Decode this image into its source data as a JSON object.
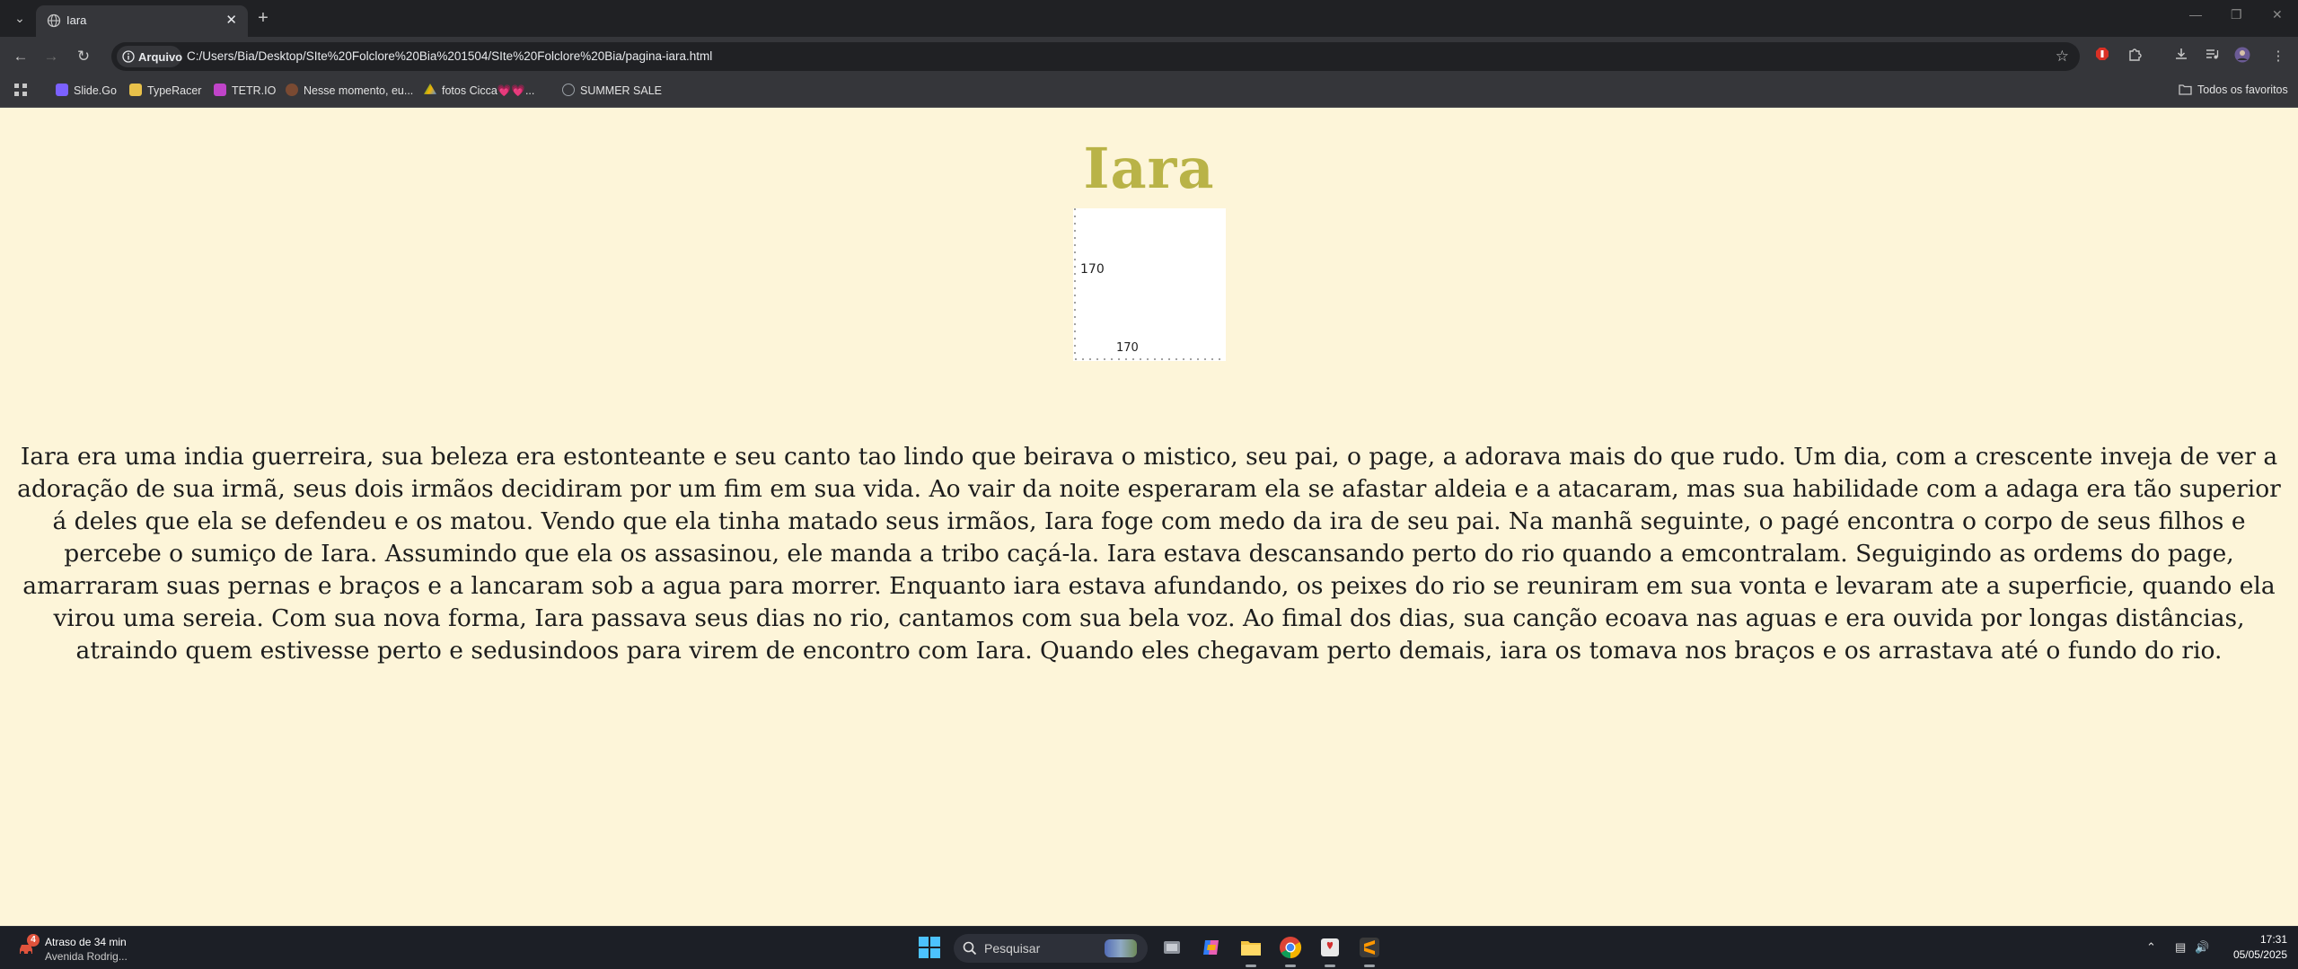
{
  "browser": {
    "tab_title": "Iara",
    "address_chip": "Arquivo",
    "url": "C:/Users/Bia/Desktop/SIte%20Folclore%20Bia%201504/SIte%20Folclore%20Bia/pagina-iara.html",
    "bookmarks": [
      {
        "label": "Slide.Go",
        "icon": "slidesgo-icon",
        "color": "#7b61ff"
      },
      {
        "label": "TypeRacer",
        "icon": "typeracer-car-icon",
        "color": "#e8c14a"
      },
      {
        "label": "TETR.IO",
        "icon": "tetrio-icon",
        "color": "#c044c9"
      },
      {
        "label": "Nesse momento, eu...",
        "icon": "avatar-icon",
        "color": "#7a4a32"
      },
      {
        "label": "fotos Cicca💗💗...",
        "icon": "google-drive-icon",
        "color": "#f4b400"
      },
      {
        "label": "SUMMER SALE",
        "icon": "globe-icon",
        "color": "#9aa0a6"
      }
    ],
    "all_bookmarks": "Todos os favoritos"
  },
  "page": {
    "title": "Iara",
    "sketch_label_left": "170",
    "sketch_label_bottom": "170",
    "story": "Iara era uma india guerreira, sua beleza era estonteante e seu canto tao lindo que beirava o mistico, seu pai, o page, a adorava mais do que rudo. Um dia, com a crescente inveja de ver a adoração de sua irmã, seus dois irmãos decidiram por um fim em sua vida. Ao vair da noite esperaram ela se afastar aldeia e a atacaram, mas sua habilidade com a adaga era tão superior á deles que ela se defendeu e os matou. Vendo que ela tinha matado seus irmãos, Iara foge com medo da ira de seu pai. Na manhã seguinte, o pagé encontra o corpo de seus filhos e percebe o sumiço de Iara. Assumindo que ela os assasinou, ele manda a tribo caçá-la. Iara estava descansando perto do rio quando a emcontralam. Seguigindo as ordems do page, amarraram suas pernas e braços e a lancaram sob a agua para morrer. Enquanto iara estava afundando, os peixes do rio se reuniram em sua vonta e levaram ate a superficie, quando ela virou uma sereia. Com sua nova forma, Iara passava seus dias no rio, cantamos com sua bela voz. Ao fimal dos dias, sua canção ecoava nas aguas e era ouvida por longas distâncias, atraindo quem estivesse perto e sedusindoos para virem de encontro com Iara. Quando eles chegavam perto demais, iara os tomava nos braços e os arrastava até o fundo do rio."
  },
  "taskbar": {
    "traffic_badge": "4",
    "traffic_title": "Atraso de 34 min",
    "traffic_subtitle": "Avenida Rodrig...",
    "search_placeholder": "Pesquisar",
    "time": "17:31",
    "date": "05/05/2025"
  },
  "colors": {
    "page_background": "#fdf5d9",
    "title_color": "#b9b347",
    "chrome_dark": "#202124",
    "chrome_toolbar": "#35363a"
  }
}
